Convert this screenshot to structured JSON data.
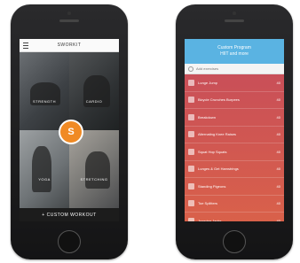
{
  "left_phone": {
    "header_title": "SWORKIT",
    "tiles": [
      {
        "label": "STRENGTH"
      },
      {
        "label": "CARDIO"
      },
      {
        "label": "YOGA"
      },
      {
        "label": "STRETCHING"
      }
    ],
    "badge": "S",
    "footer_label": "+ CUSTOM WORKOUT"
  },
  "right_phone": {
    "header_line1": "Custom Program",
    "header_line2": "HIIT and more",
    "search_placeholder": "Add exercises",
    "rows": [
      {
        "label": "Lunge Jump",
        "value": "40"
      },
      {
        "label": "Bicycle Crunches Burpees",
        "value": "40"
      },
      {
        "label": "Breakdown",
        "value": "40"
      },
      {
        "label": "Alternating Knee Raises",
        "value": "40"
      },
      {
        "label": "Squat Hop Squats",
        "value": "40"
      },
      {
        "label": "Lunges & Get Hamstrings",
        "value": "40"
      },
      {
        "label": "Standing Pigeons",
        "value": "40"
      },
      {
        "label": "Toe Splitters",
        "value": "40"
      },
      {
        "label": "Jumping Jacks",
        "value": "40"
      }
    ],
    "gradient_top": "#c94f58",
    "gradient_bottom": "#d9614a"
  }
}
